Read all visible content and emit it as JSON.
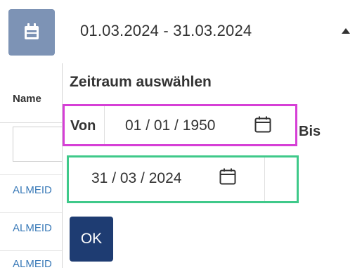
{
  "date_range": {
    "value": "01.03.2024 - 31.03.2024",
    "calendar_icon": "calendar-icon",
    "toggle_icon": "caret-up-icon"
  },
  "table": {
    "column_header": "Name",
    "rows": [
      "ALMEID",
      "ALMEID",
      "ALMEID"
    ],
    "link_color": "#3a7ab8"
  },
  "picker": {
    "title": "Zeitraum auswählen",
    "from_label": "Von",
    "from_date": "01 / 01 / 1950",
    "to_label": "Bis",
    "to_date": "31 / 03 / 2024",
    "ok_label": "OK",
    "ok_color": "#1e3c72",
    "highlight_from_color": "#d63fd6",
    "highlight_to_color": "#3fc98a"
  }
}
